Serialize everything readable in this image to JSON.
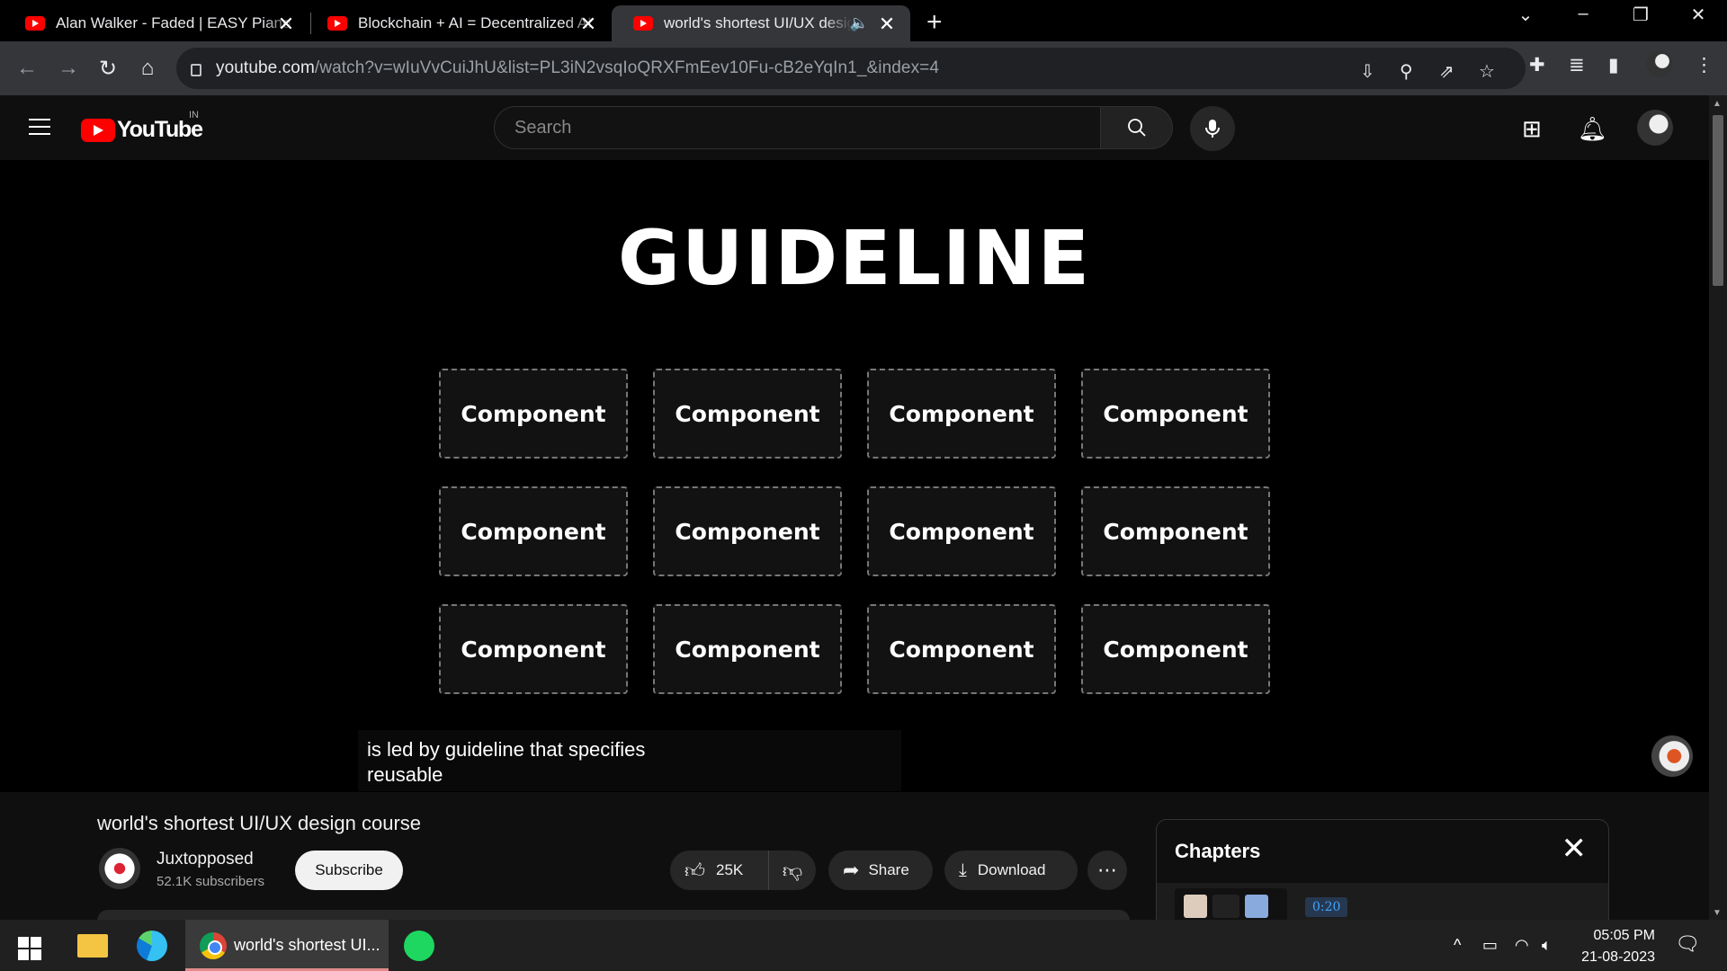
{
  "browser": {
    "tabs": [
      {
        "title": "Alan Walker - Faded | EASY Piano",
        "active": false
      },
      {
        "title": "Blockchain + AI = Decentralized AI",
        "active": false
      },
      {
        "title": "world's shortest UI/UX design course",
        "active": true
      }
    ],
    "url_host": "youtube.com",
    "url_path": "/watch?v=wIuVvCuiJhU&list=PL3iN2vsqIoQRXFmEev10Fu-cB2eYqIn1_&index=4"
  },
  "youtube": {
    "logo_text": "YouTube",
    "country": "IN",
    "search_placeholder": "Search"
  },
  "video": {
    "slide_title": "GUIDELINE",
    "components": [
      "Component",
      "Component",
      "Component",
      "Component",
      "Component",
      "Component",
      "Component",
      "Component",
      "Component",
      "Component",
      "Component",
      "Component"
    ],
    "caption_line1": "is led by guideline that specifies",
    "caption_line2": "reusable"
  },
  "info": {
    "title": "world's shortest UI/UX design course",
    "channel": "Juxtopposed",
    "subscribers": "52.1K subscribers",
    "subscribe_label": "Subscribe",
    "likes": "25K",
    "share_label": "Share",
    "download_label": "Download"
  },
  "chapters": {
    "heading": "Chapters",
    "timestamp": "0:20"
  },
  "taskbar": {
    "chrome_window": "world's shortest UI...",
    "time": "05:05 PM",
    "date": "21-08-2023"
  }
}
